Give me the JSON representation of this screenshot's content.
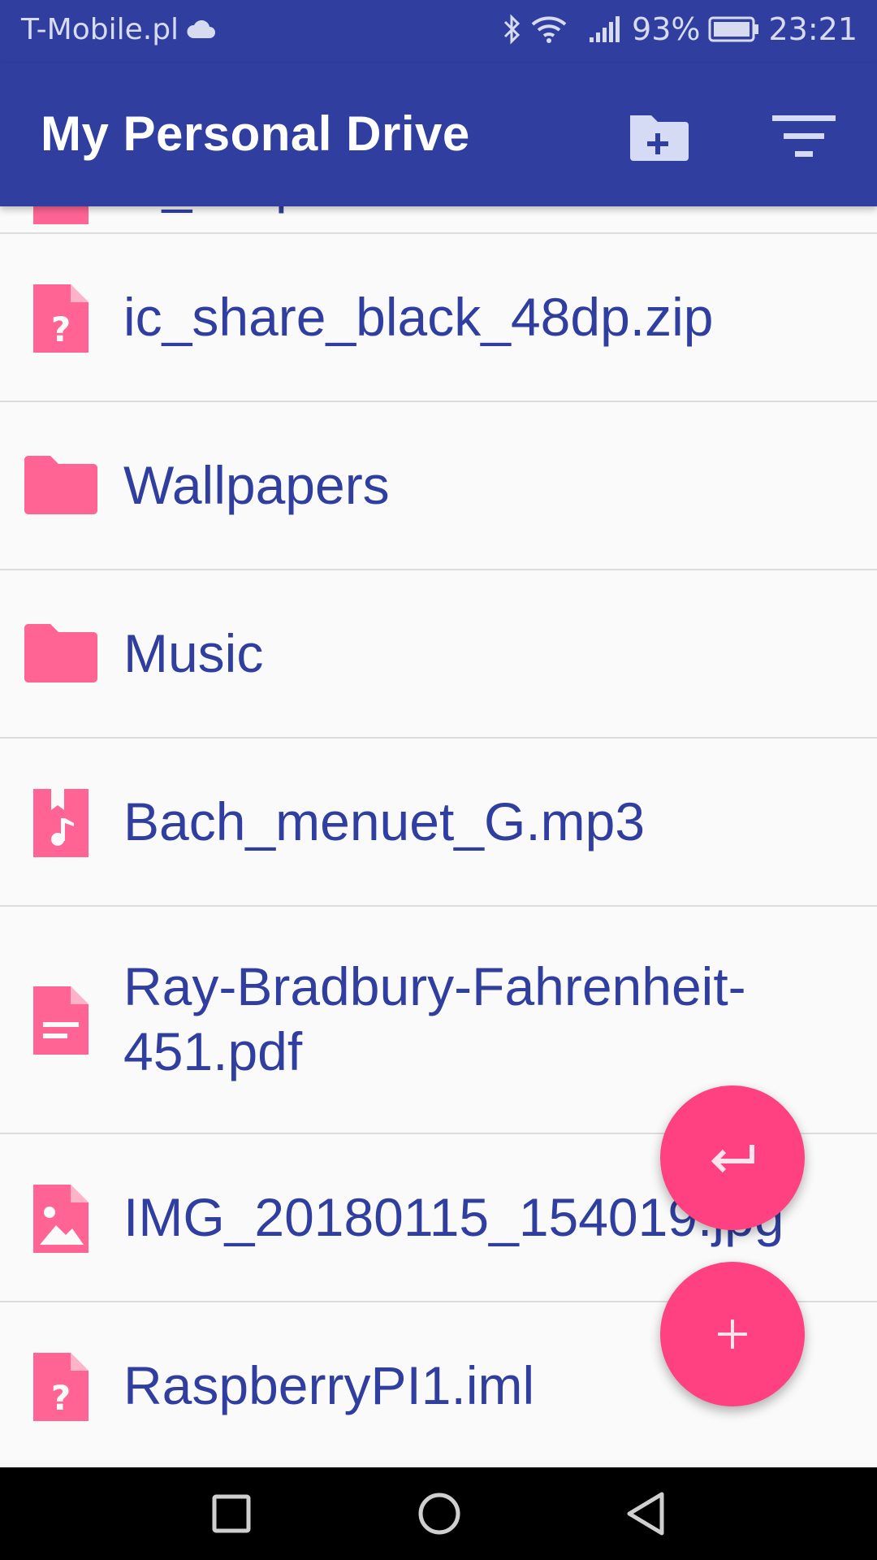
{
  "status_bar": {
    "carrier": "T-Mobile.pl",
    "battery_percent": "93%",
    "time": "23:21",
    "icons": [
      "cloud-icon",
      "bluetooth-icon",
      "wifi-icon",
      "signal-icon",
      "battery-icon"
    ]
  },
  "app_bar": {
    "title": "My Personal Drive",
    "actions": [
      "new-folder-icon",
      "filter-icon"
    ]
  },
  "files": [
    {
      "name": "ic_...zip",
      "type": "unknown",
      "icon": "unknown-file-icon"
    },
    {
      "name": "ic_share_black_48dp.zip",
      "type": "unknown",
      "icon": "unknown-file-icon"
    },
    {
      "name": "Wallpapers",
      "type": "folder",
      "icon": "folder-icon"
    },
    {
      "name": "Music",
      "type": "folder",
      "icon": "folder-icon"
    },
    {
      "name": "Bach_menuet_G.mp3",
      "type": "audio",
      "icon": "audio-file-icon"
    },
    {
      "name": "Ray-Bradbury-Fahrenheit-451.pdf",
      "type": "document",
      "icon": "document-file-icon"
    },
    {
      "name": "IMG_20180115_154019.jpg",
      "type": "image",
      "icon": "image-file-icon"
    },
    {
      "name": "RaspberryPI1.iml",
      "type": "unknown",
      "icon": "unknown-file-icon"
    }
  ],
  "fabs": [
    "back-arrow-icon",
    "plus-icon"
  ],
  "colors": {
    "primary": "#303f9f",
    "accent": "#ff4081",
    "icon_pink": "#ff6495"
  },
  "nav_bar": [
    "recents-square-icon",
    "home-circle-icon",
    "back-triangle-icon"
  ]
}
